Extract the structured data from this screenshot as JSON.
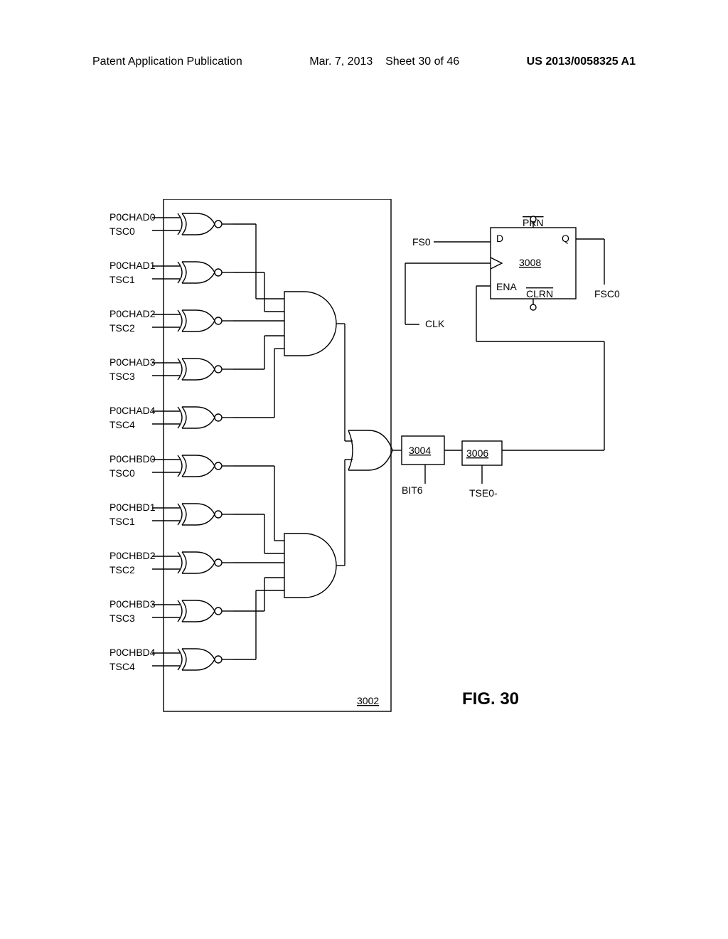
{
  "header": {
    "doc_type": "Patent Application Publication",
    "date": "Mar. 7, 2013",
    "sheet": "Sheet 30 of 46",
    "pub_number": "US 2013/0058325 A1"
  },
  "diagram": {
    "inputs": [
      {
        "top": "P0CHAD0",
        "bottom": "TSC0"
      },
      {
        "top": "P0CHAD1",
        "bottom": "TSC1"
      },
      {
        "top": "P0CHAD2",
        "bottom": "TSC2"
      },
      {
        "top": "P0CHAD3",
        "bottom": "TSC3"
      },
      {
        "top": "P0CHAD4",
        "bottom": "TSC4"
      },
      {
        "top": "P0CHBD0",
        "bottom": "TSC0"
      },
      {
        "top": "P0CHBD1",
        "bottom": "TSC1"
      },
      {
        "top": "P0CHBD2",
        "bottom": "TSC2"
      },
      {
        "top": "P0CHBD3",
        "bottom": "TSC3"
      },
      {
        "top": "P0CHBD4",
        "bottom": "TSC4"
      }
    ],
    "block_refs": {
      "xor_block": "3002",
      "or_main": "3004",
      "inv": "3006",
      "dff": "3008"
    },
    "signals": {
      "fs0": "FS0",
      "clk": "CLK",
      "bit6": "BIT6",
      "tse0": "TSE0-",
      "fsc0": "FSC0"
    },
    "dff_labels": {
      "d": "D",
      "prn": "PRN",
      "q": "Q",
      "ena": "ENA",
      "clrn": "CLRN"
    },
    "figure_caption": "FIG. 30"
  }
}
